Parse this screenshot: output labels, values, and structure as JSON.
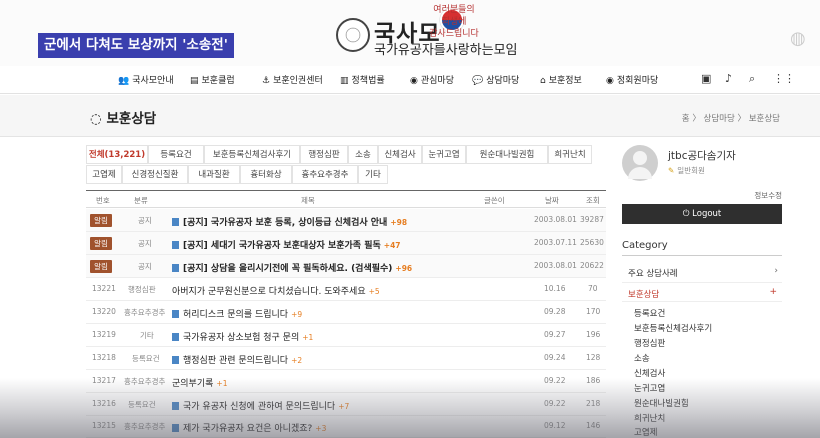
{
  "broadcast_caption": "군에서 다쳐도 보상까지 '소송전'",
  "site": {
    "logo_main": "국사모",
    "logo_sub": "국가유공자를사랑하는모임",
    "slogan": [
      "여러분들의",
      "희생에",
      "감사드립니다"
    ]
  },
  "nav": {
    "items": [
      {
        "icon": "users-icon",
        "glyph": "👥",
        "label": "국사모안내"
      },
      {
        "icon": "clipboard-icon",
        "glyph": "▤",
        "label": "보훈클럽"
      },
      {
        "icon": "anchor-icon",
        "glyph": "⚓",
        "label": "보훈인권센터"
      },
      {
        "icon": "chart-icon",
        "glyph": "▥",
        "label": "정책법률"
      },
      {
        "icon": "eye-icon",
        "glyph": "◉",
        "label": "관심마당"
      },
      {
        "icon": "chat-icon",
        "glyph": "💬",
        "label": "상담마당"
      },
      {
        "icon": "bank-icon",
        "glyph": "⌂",
        "label": "보훈정보"
      },
      {
        "icon": "eye-icon-2",
        "glyph": "◉",
        "label": "정회원마당"
      }
    ],
    "right_icons": [
      "briefcase-icon",
      "bell-icon",
      "search-icon",
      "grid-icon"
    ]
  },
  "page": {
    "title": "보훈상담",
    "breadcrumb": "홈 〉 상담마당 〉 보훈상담"
  },
  "tabs": [
    "전체(13,221)",
    "등록요건",
    "보훈등록신체검사후기",
    "행정심판",
    "소송",
    "신체검사",
    "눈귀고엽",
    "원순대나빌권힘",
    "희귀난치",
    "고엽제",
    "신경정신질환",
    "내과질환",
    "흉터화상",
    "흉추요추경추",
    "기타"
  ],
  "table": {
    "headers": {
      "num": "번호",
      "category": "분류",
      "subject": "제목",
      "author": "글쓴이",
      "date": "날짜",
      "views": "조회"
    },
    "rows": [
      {
        "num": "알림",
        "category": "공지",
        "subject": "[공지] 국가유공자 보훈 등록, 상이등급 신체검사 안내",
        "count": "98",
        "author": "",
        "date": "2003.08.01",
        "views": "39287",
        "notice": true
      },
      {
        "num": "알림",
        "category": "공지",
        "subject": "[공지] 세대기 국가유공자 보훈대상자 보훈가족 필독",
        "count": "47",
        "author": "",
        "date": "2003.07.11",
        "views": "25630",
        "notice": true
      },
      {
        "num": "알림",
        "category": "공지",
        "subject": "[공지] 상담을 올리시기전에 꼭 필독하세요. (검색필수)",
        "count": "96",
        "author": "",
        "date": "2003.08.01",
        "views": "20622",
        "notice": true
      },
      {
        "num": "13221",
        "category": "행정심판",
        "subject": "아버지가 군무원신분으로 다치셨습니다. 도와주세요",
        "count": "5",
        "author": "",
        "date": "10.16",
        "views": "70",
        "notice": false
      },
      {
        "num": "13220",
        "category": "흉추요추경추",
        "subject": "허리디스크 문의를 드립니다",
        "count": "9",
        "author": "",
        "date": "09.28",
        "views": "170",
        "notice": false
      },
      {
        "num": "13219",
        "category": "기타",
        "subject": "국가유공자 상소보험 청구 문의",
        "count": "1",
        "author": "",
        "date": "09.27",
        "views": "196",
        "notice": false
      },
      {
        "num": "13218",
        "category": "등록요건",
        "subject": "행정심판 관련 문의드립니다",
        "count": "2",
        "author": "",
        "date": "09.24",
        "views": "128",
        "notice": false
      },
      {
        "num": "13217",
        "category": "흉추요추경추",
        "subject": "군의부기록",
        "count": "1",
        "author": "",
        "date": "09.22",
        "views": "186",
        "notice": false
      },
      {
        "num": "13216",
        "category": "등록요건",
        "subject": "국가 유공자 신청에 관하여 문의드립니다",
        "count": "7",
        "author": "",
        "date": "09.22",
        "views": "218",
        "notice": false
      },
      {
        "num": "13215",
        "category": "흉추요추경추",
        "subject": "제가 국가유공자 요건은 아니겠죠?",
        "count": "3",
        "author": "",
        "date": "09.12",
        "views": "146",
        "notice": false
      }
    ]
  },
  "sidebar": {
    "user_name": "jtbc공다솜기자",
    "user_role": "일반회원",
    "edit_info": "정보수정",
    "logout_label": "Logout",
    "category_title": "Category",
    "categories": [
      {
        "label": "주요 상담사례",
        "marker": "›",
        "active": false
      },
      {
        "label": "보훈상담",
        "marker": "+",
        "active": true
      }
    ],
    "sub_items": [
      "등록요건",
      "보훈등록신체검사후기",
      "행정심판",
      "소송",
      "신체검사",
      "눈귀고엽",
      "원순대나빌권힘",
      "희귀난치",
      "고엽제"
    ]
  },
  "colors": {
    "accent": "#c0392b",
    "notice_badge": "#a0522d",
    "caption_bg": "#3a3fae"
  }
}
